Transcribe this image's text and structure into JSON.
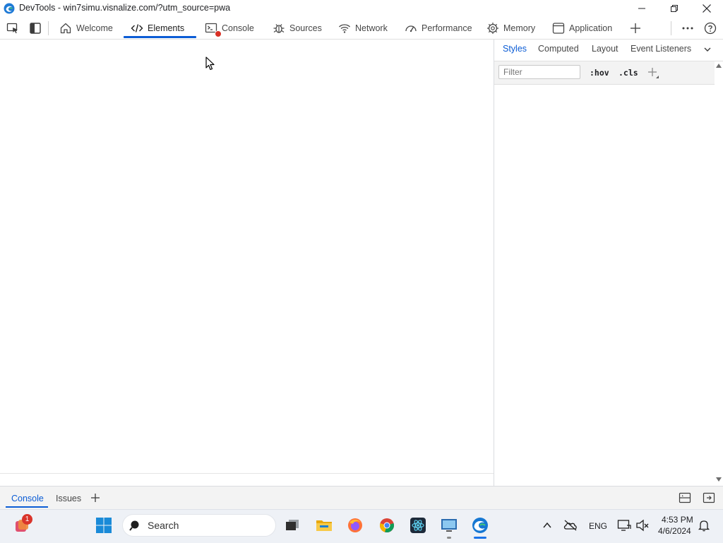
{
  "window": {
    "title": "DevTools - win7simu.visnalize.com/?utm_source=pwa"
  },
  "toolbar": {
    "tabs": [
      {
        "label": "Welcome",
        "icon": "home-icon"
      },
      {
        "label": "Elements",
        "icon": "code-icon",
        "active": true
      },
      {
        "label": "Console",
        "icon": "console-icon",
        "has_error": true
      },
      {
        "label": "Sources",
        "icon": "bug-icon"
      },
      {
        "label": "Network",
        "icon": "wifi-icon"
      },
      {
        "label": "Performance",
        "icon": "gauge-icon"
      },
      {
        "label": "Memory",
        "icon": "chip-icon"
      },
      {
        "label": "Application",
        "icon": "app-window-icon"
      }
    ]
  },
  "styles_panel": {
    "tabs": [
      "Styles",
      "Computed",
      "Layout",
      "Event Listeners"
    ],
    "active_tab": "Styles",
    "filter_placeholder": "Filter",
    "hov_label": ":hov",
    "cls_label": ".cls"
  },
  "drawer": {
    "tabs": [
      "Console",
      "Issues"
    ],
    "active_tab": "Console"
  },
  "taskbar": {
    "notification_badge": "1",
    "search_label": "Search",
    "language": "ENG",
    "time": "4:53 PM",
    "date": "4/6/2024"
  },
  "colors": {
    "accent": "#0b5cd5",
    "error": "#d93025",
    "taskbar_bg": "#eef1f6"
  }
}
